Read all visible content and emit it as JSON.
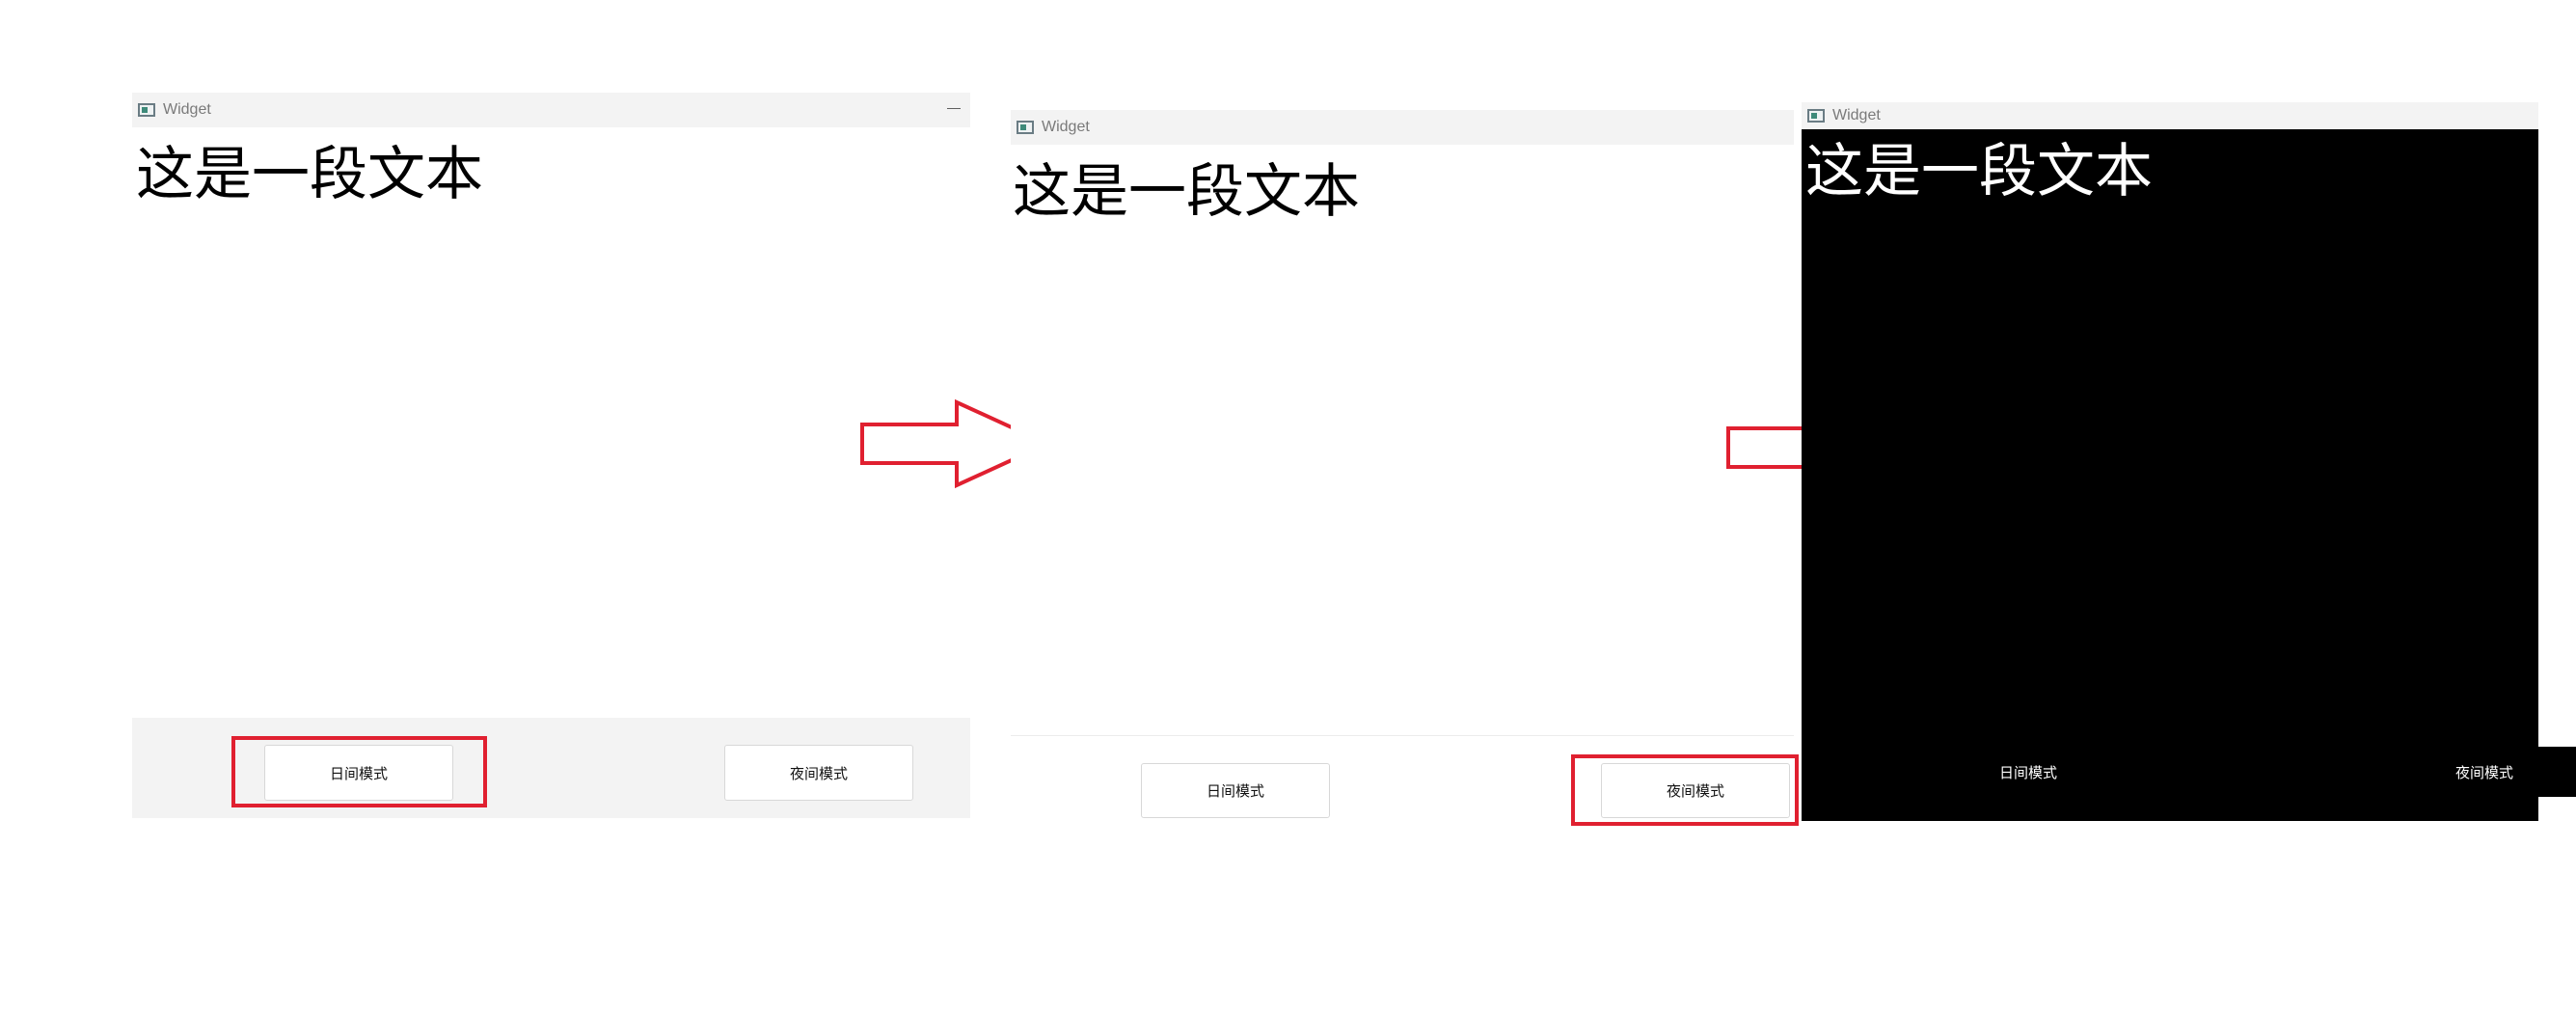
{
  "panels": [
    {
      "title": "Widget",
      "text": "这是一段文本",
      "day_button": "日间模式",
      "night_button": "夜间模式",
      "minimize_glyph": "—",
      "theme": "day",
      "highlight": "day"
    },
    {
      "title": "Widget",
      "text": "这是一段文本",
      "day_button": "日间模式",
      "night_button": "夜间模式",
      "theme": "day",
      "highlight": "night"
    },
    {
      "title": "Widget",
      "text": "这是一段文本",
      "day_button": "日间模式",
      "night_button": "夜间模式",
      "theme": "night",
      "highlight": "none"
    }
  ],
  "colors": {
    "highlight": "#e02030",
    "day_bg": "#ffffff",
    "day_chrome": "#f3f3f3",
    "night_bg": "#000000",
    "night_text": "#ffffff"
  },
  "icons": [
    "window-app-icon",
    "arrow-right-icon"
  ]
}
